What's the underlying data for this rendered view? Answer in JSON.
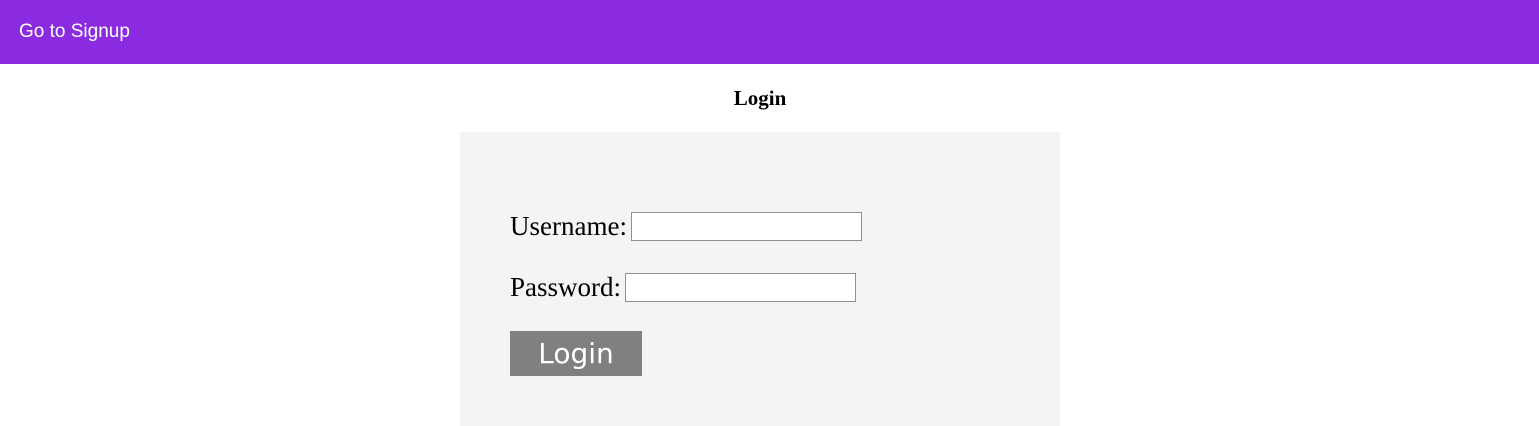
{
  "header": {
    "nav_link_label": "Go to Signup",
    "background_color": "#8a2be2"
  },
  "main": {
    "title": "Login",
    "form": {
      "username_label": "Username:",
      "username_value": "",
      "password_label": "Password:",
      "password_value": "",
      "submit_label": "Login",
      "panel_color": "#f4f4f4",
      "button_color": "#808080"
    }
  }
}
